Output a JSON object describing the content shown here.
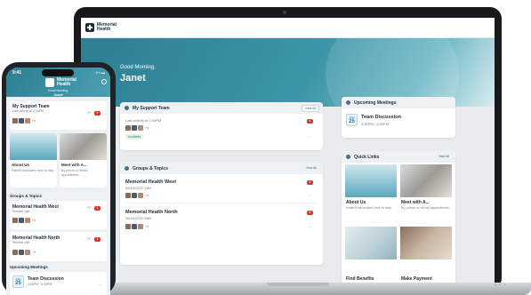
{
  "brand": {
    "name_line1": "Memorial",
    "name_line2": "Health"
  },
  "desktop": {
    "greeting": "Good Morning,",
    "user_name": "Janet",
    "support_team": {
      "title": "My Support Team",
      "view_all": "View All",
      "last_activity": "Last activity at 2:34PM",
      "badge": "1",
      "more": "+4",
      "status": "Available"
    },
    "groups": {
      "title": "Groups & Topics",
      "view_all": "View All",
      "items": [
        {
          "name": "Memorial Health West",
          "date": "06/15/2022 Visit",
          "badge": "1",
          "more": "+4"
        },
        {
          "name": "Memorial Health North",
          "date": "06/16/2022 Visit",
          "badge": "2",
          "more": "+4"
        }
      ]
    },
    "meetings": {
      "title": "Upcoming Meetings",
      "month": "JUN",
      "day": "25",
      "name": "Team Discussion",
      "time": "3:30PM - 4:30PM"
    },
    "quick_links": {
      "title": "Quick Links",
      "view_all": "View All",
      "tiles": [
        {
          "title": "About Us",
          "sub": "Patient advocates here to help."
        },
        {
          "title": "Meet with A...",
          "sub": "By phone or virtual appointment."
        },
        {
          "title": "Find Benefits",
          "sub": ""
        },
        {
          "title": "Make Payment",
          "sub": ""
        }
      ]
    }
  },
  "phone": {
    "time": "9:41",
    "status_icons": "..ll ≈ ▬",
    "greeting_line1": "Good Morning,",
    "greeting_line2": "Janet",
    "support_team": {
      "title": "My Support Team",
      "last_activity": "Last activity at 2:34PM",
      "badge": "1",
      "more": "+4"
    },
    "tiles": [
      {
        "title": "About Us",
        "sub": "Patient advocates here to help."
      },
      {
        "title": "Meet with A...",
        "sub": "By phone or virtual appointment."
      }
    ],
    "groups_title": "Groups & Topics",
    "groups": [
      {
        "name": "Memorial Health West",
        "sub": "Remote visit.",
        "badge": "1",
        "more": "+4"
      },
      {
        "name": "Memorial Health North",
        "sub": "Remote visit.",
        "badge": "1",
        "more": "+4"
      }
    ],
    "meetings_title": "Upcoming Meetings",
    "meeting": {
      "month": "JUN",
      "day": "25",
      "name": "Team Discussion",
      "time": "3:30PM - 4:30PM"
    }
  },
  "colors": {
    "accent": "#2d7f93",
    "badge": "#d8342b",
    "link": "#2e6fa6"
  }
}
